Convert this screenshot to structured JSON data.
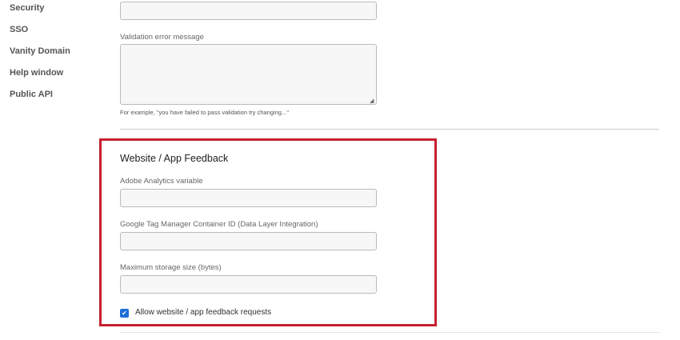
{
  "sidebar": {
    "items": [
      {
        "label": "Security"
      },
      {
        "label": "SSO"
      },
      {
        "label": "Vanity Domain"
      },
      {
        "label": "Help window"
      },
      {
        "label": "Public API"
      }
    ]
  },
  "validation": {
    "error_label": "Validation error message",
    "hint": "For example, \"you have failed to pass validation try changing...\""
  },
  "feedback": {
    "title": "Website / App Feedback",
    "adobe_label": "Adobe Analytics variable",
    "gtm_label": "Google Tag Manager Container ID (Data Layer Integration)",
    "storage_label": "Maximum storage size (bytes)",
    "allow_label": "Allow website / app feedback requests",
    "allow_checked": true
  },
  "colors": {
    "highlight": "#c4202f",
    "accent": "#1d6fd6"
  }
}
